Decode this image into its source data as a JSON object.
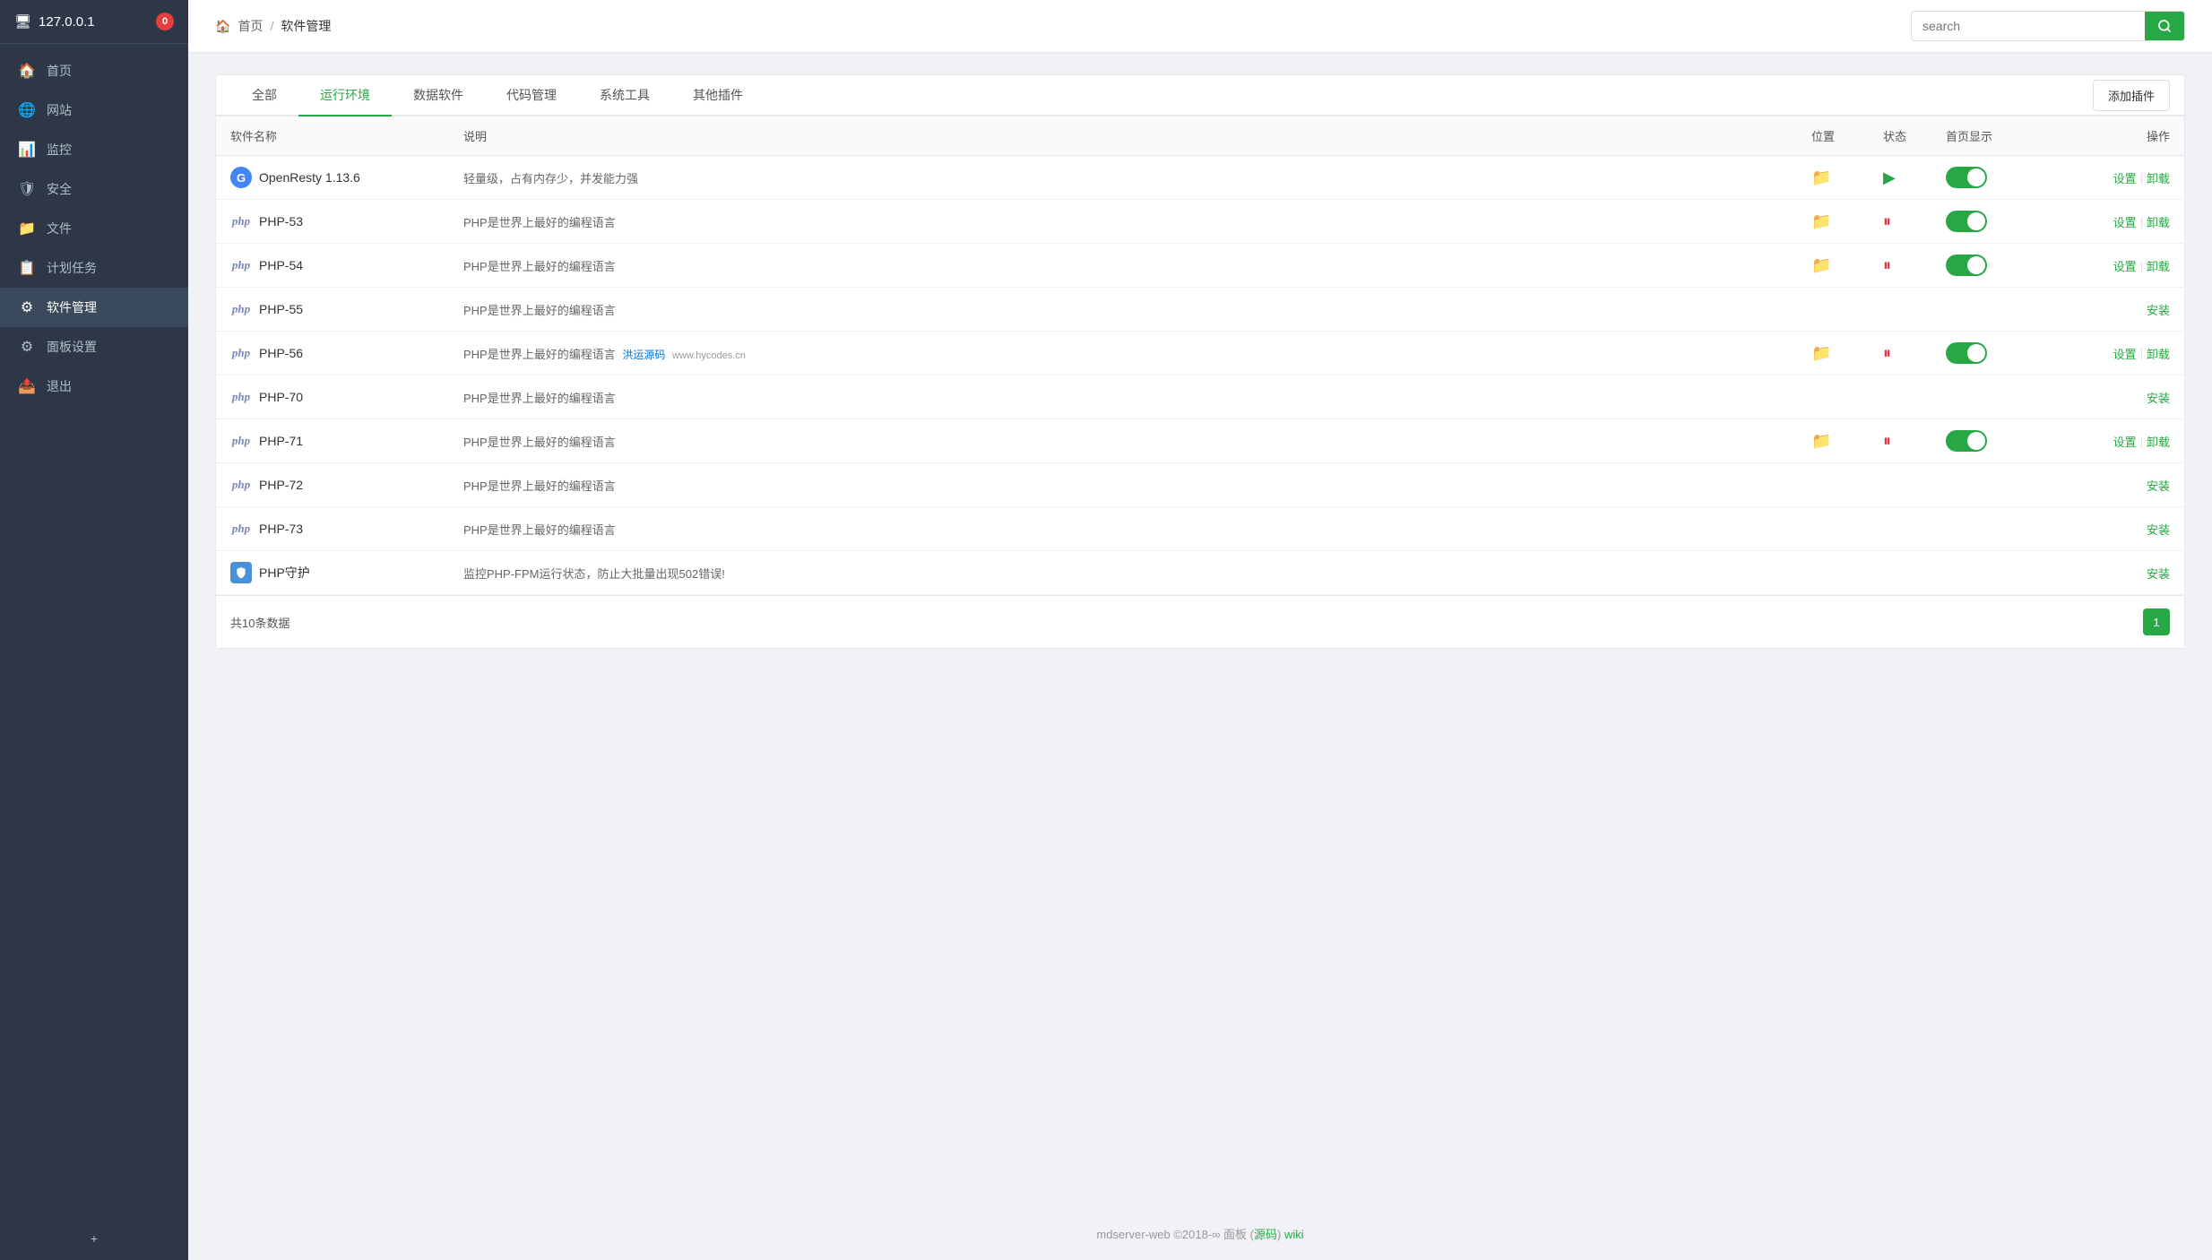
{
  "sidebar": {
    "server": "127.0.0.1",
    "badge": "0",
    "items": [
      {
        "id": "home",
        "label": "首页",
        "icon": "🏠"
      },
      {
        "id": "website",
        "label": "网站",
        "icon": "🌐"
      },
      {
        "id": "monitor",
        "label": "监控",
        "icon": "📊"
      },
      {
        "id": "security",
        "label": "安全",
        "icon": "🛡"
      },
      {
        "id": "files",
        "label": "文件",
        "icon": "📁"
      },
      {
        "id": "schedule",
        "label": "计划任务",
        "icon": "📋"
      },
      {
        "id": "software",
        "label": "软件管理",
        "icon": "⚙"
      },
      {
        "id": "settings",
        "label": "面板设置",
        "icon": "⚙"
      },
      {
        "id": "logout",
        "label": "退出",
        "icon": "📤"
      }
    ],
    "add_label": "+"
  },
  "breadcrumb": {
    "home": "首页",
    "separator": "/",
    "current": "软件管理"
  },
  "search": {
    "placeholder": "search"
  },
  "tabs": {
    "items": [
      {
        "id": "all",
        "label": "全部",
        "active": false
      },
      {
        "id": "runtime",
        "label": "运行环境",
        "active": true
      },
      {
        "id": "database",
        "label": "数据软件",
        "active": false
      },
      {
        "id": "code",
        "label": "代码管理",
        "active": false
      },
      {
        "id": "tools",
        "label": "系统工具",
        "active": false
      },
      {
        "id": "plugins",
        "label": "其他插件",
        "active": false
      }
    ],
    "add_plugin": "添加插件"
  },
  "table": {
    "headers": {
      "name": "软件名称",
      "desc": "说明",
      "location": "位置",
      "status": "状态",
      "homepage": "首页显示",
      "action": "操作"
    },
    "rows": [
      {
        "id": "openresty",
        "icon_type": "openresty",
        "name": "OpenResty 1.13.6",
        "desc": "轻量级，占有内存少，并发能力强",
        "has_location": true,
        "status": "running",
        "has_homepage": true,
        "actions": [
          "设置",
          "卸载"
        ]
      },
      {
        "id": "php53",
        "icon_type": "php",
        "name": "PHP-53",
        "desc": "PHP是世界上最好的编程语言",
        "has_location": true,
        "status": "paused",
        "has_homepage": true,
        "actions": [
          "设置",
          "卸载"
        ]
      },
      {
        "id": "php54",
        "icon_type": "php",
        "name": "PHP-54",
        "desc": "PHP是世界上最好的编程语言",
        "has_location": true,
        "status": "paused",
        "has_homepage": true,
        "actions": [
          "设置",
          "卸载"
        ]
      },
      {
        "id": "php55",
        "icon_type": "php",
        "name": "PHP-55",
        "desc": "PHP是世界上最好的编程语言",
        "has_location": false,
        "status": null,
        "has_homepage": false,
        "actions": [
          "安装"
        ]
      },
      {
        "id": "php56",
        "icon_type": "php",
        "name": "PHP-56",
        "desc": "PHP是世界上最好的编程语言",
        "desc_extra": "洪运源码",
        "desc_watermark": "www.hycodes.cn",
        "has_location": true,
        "status": "paused",
        "has_homepage": true,
        "actions": [
          "设置",
          "卸载"
        ]
      },
      {
        "id": "php70",
        "icon_type": "php",
        "name": "PHP-70",
        "desc": "PHP是世界上最好的编程语言",
        "has_location": false,
        "status": null,
        "has_homepage": false,
        "actions": [
          "安装"
        ]
      },
      {
        "id": "php71",
        "icon_type": "php",
        "name": "PHP-71",
        "desc": "PHP是世界上最好的编程语言",
        "has_location": true,
        "status": "paused",
        "has_homepage": true,
        "actions": [
          "设置",
          "卸载"
        ]
      },
      {
        "id": "php72",
        "icon_type": "php",
        "name": "PHP-72",
        "desc": "PHP是世界上最好的编程语言",
        "has_location": false,
        "status": null,
        "has_homepage": false,
        "actions": [
          "安装"
        ]
      },
      {
        "id": "php73",
        "icon_type": "php",
        "name": "PHP-73",
        "desc": "PHP是世界上最好的编程语言",
        "has_location": false,
        "status": null,
        "has_homepage": false,
        "actions": [
          "安装"
        ]
      },
      {
        "id": "phpguard",
        "icon_type": "phpguard",
        "name": "PHP守护",
        "desc": "监控PHP-FPM运行状态，防止大批量出现502错误!",
        "has_location": false,
        "status": null,
        "has_homepage": false,
        "actions": [
          "安装"
        ]
      }
    ],
    "total": "共10条数据",
    "page": "1"
  },
  "footer": {
    "text": "mdserver-web ©2018-∞ 面板 (",
    "source_link": "源码",
    "separator": ")",
    "wiki_link": "wiki"
  }
}
